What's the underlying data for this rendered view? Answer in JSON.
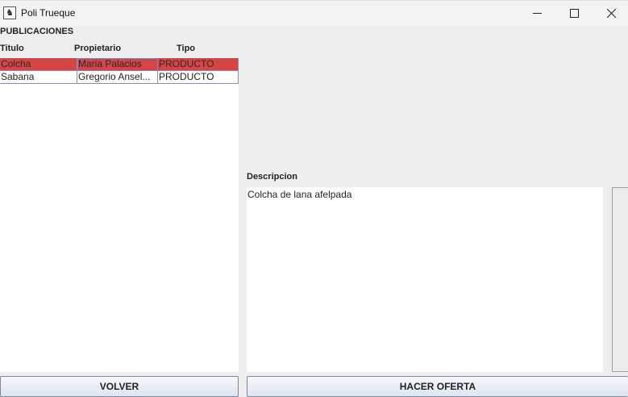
{
  "window": {
    "title": "Poli Trueque",
    "icon": "app-icon",
    "controls": [
      "minimize-icon",
      "maximize-icon",
      "close-icon"
    ]
  },
  "publicaciones": {
    "label": "PUBLICACIONES",
    "columns": [
      "Titulo",
      "Propietario",
      "Tipo"
    ],
    "rows": [
      {
        "titulo": "Colcha",
        "propietario": "Maria Palacios",
        "tipo": "PRODUCTO",
        "selected": true
      },
      {
        "titulo": "Sabana",
        "propietario": "Gregorio Ansel...",
        "tipo": "PRODUCTO",
        "selected": false
      }
    ]
  },
  "descripcion": {
    "label": "Descripcion",
    "text": "Colcha de lana afelpada"
  },
  "buttons": {
    "volver": "VOLVER",
    "hacer_oferta": "HACER OFERTA"
  },
  "colors": {
    "selected_row": "#d64545",
    "background": "#eeeeee"
  }
}
